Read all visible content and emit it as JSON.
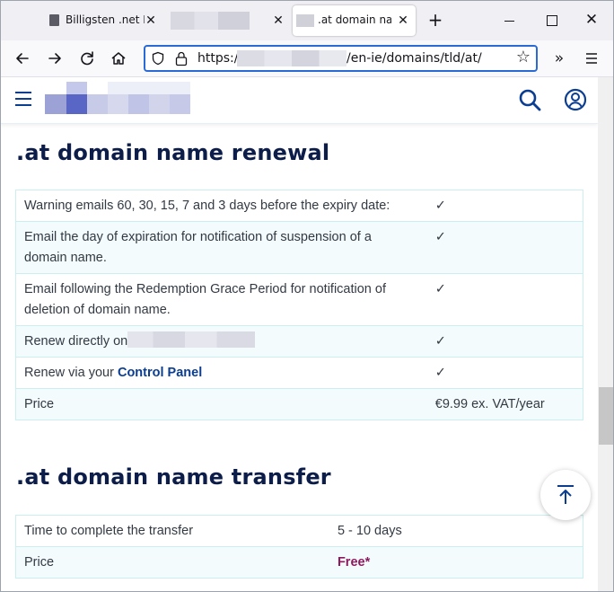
{
  "browser": {
    "tabs": [
      {
        "title": "Billigsten .net Do"
      },
      {
        "title": ""
      },
      {
        "title": ".at domain nam"
      }
    ],
    "url": {
      "scheme": "https://",
      "path": "/en-ie/domains/tld/at/"
    }
  },
  "renewal": {
    "title": ".at domain name renewal",
    "rows": [
      {
        "label": "Warning emails 60, 30, 15, 7 and 3 days before the expiry date:",
        "value": "✓"
      },
      {
        "label": "Email the day of expiration for notification of suspension of a domain name.",
        "value": "✓"
      },
      {
        "label": "Email following the Redemption Grace Period for notification of deletion of domain name.",
        "value": "✓"
      },
      {
        "label_prefix": "Renew directly on",
        "value": "✓"
      },
      {
        "label_prefix": "Renew via your",
        "link": "Control Panel",
        "value": "✓"
      },
      {
        "label": "Price",
        "value": "€9.99 ex. VAT/year"
      }
    ]
  },
  "transfer": {
    "title": ".at domain name transfer",
    "rows": [
      {
        "label": "Time to complete the transfer",
        "value": "5 - 10 days"
      },
      {
        "label": "Price",
        "value": "Free*"
      }
    ]
  },
  "colors": {
    "brand": "#0b3d91",
    "heading": "#0d1d4a",
    "free_price": "#8b1a5e",
    "url_focus": "#2a6ad6"
  }
}
